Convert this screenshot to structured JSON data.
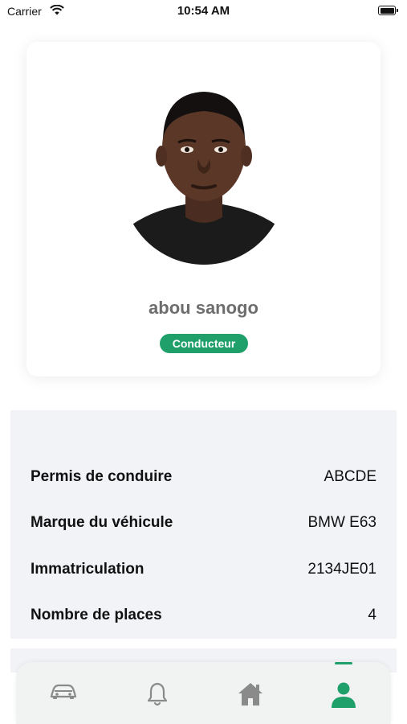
{
  "status_bar": {
    "carrier": "Carrier",
    "time": "10:54 AM"
  },
  "profile": {
    "name": "abou sanogo",
    "role": "Conducteur",
    "accent_color": "#1fa06a"
  },
  "details": [
    {
      "label": "Permis de conduire",
      "value": "ABCDE"
    },
    {
      "label": "Marque du véhicule",
      "value": "BMW E63"
    },
    {
      "label": "Immatriculation",
      "value": "2134JE01"
    },
    {
      "label": "Nombre de places",
      "value": "4"
    }
  ],
  "tab_bar": {
    "tabs": [
      {
        "icon": "car-icon",
        "active": false
      },
      {
        "icon": "bell-icon",
        "active": false
      },
      {
        "icon": "home-icon",
        "active": false
      },
      {
        "icon": "user-icon",
        "active": true
      }
    ]
  }
}
